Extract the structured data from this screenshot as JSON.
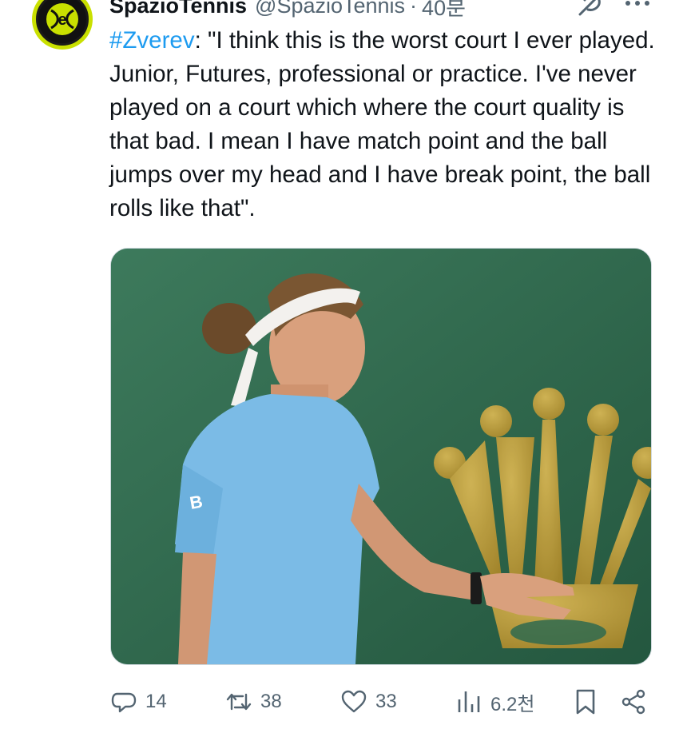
{
  "post": {
    "author": {
      "display_name": "SpazioTennis",
      "handle": "@SpazioTennis",
      "time_separator": "·",
      "time": "40분"
    },
    "text": {
      "hashtag": "#Zverev",
      "body": ": \"I think this is the worst court I ever played. Junior, Futures, professional or practice. I've never played on a court which where the court quality is that bad. I mean I have match point and the ball jumps over my head and I have break point, the ball rolls like that\"."
    },
    "media": {
      "icon": "photo-tennis-player"
    },
    "actions": {
      "replies": "14",
      "reposts": "38",
      "likes": "33",
      "views": "6.2천"
    }
  },
  "icons": {
    "avatar": "tennis-ball-logo-icon",
    "grok": "grok-icon",
    "more": "more-icon",
    "reply": "reply-icon",
    "repost": "repost-icon",
    "like": "heart-icon",
    "views": "views-chart-icon",
    "bookmark": "bookmark-icon",
    "share": "share-icon"
  },
  "colors": {
    "hashtag": "#1d9bf0",
    "secondary_text": "#536471",
    "avatar_ring": "#c9e000",
    "court_green": "#2f6a4f",
    "crown_gold": "#c9a23a",
    "shirt_blue": "#7bbbe6"
  }
}
